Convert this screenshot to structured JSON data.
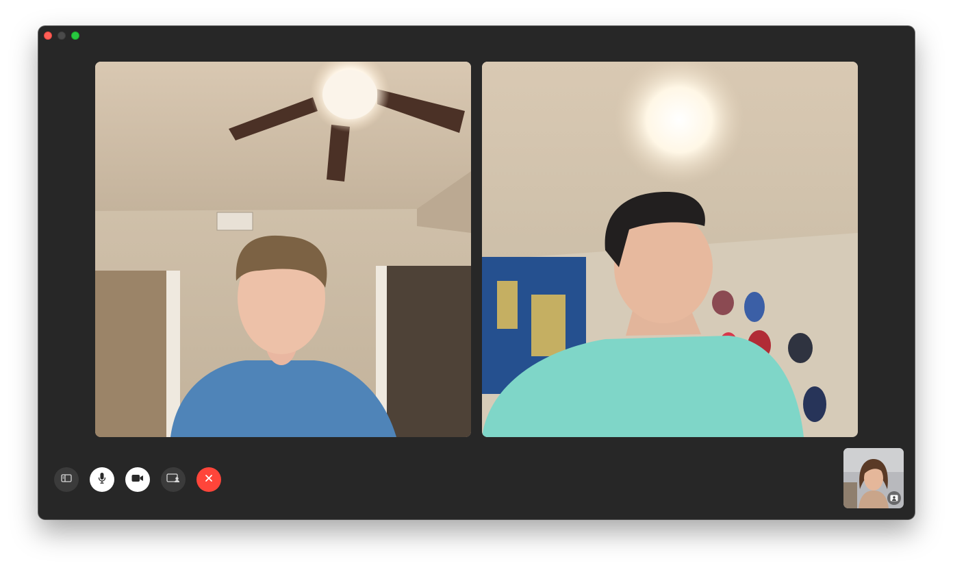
{
  "window": {
    "title_bar": {
      "close": "close",
      "minimize": "minimize",
      "zoom": "zoom"
    }
  },
  "participants": [
    {
      "role": "remote",
      "icon": "video-feed"
    },
    {
      "role": "remote",
      "icon": "video-feed"
    }
  ],
  "self_view": {
    "icon": "self-video-feed",
    "badge_icon": "person-card-icon"
  },
  "controls": [
    {
      "id": "sidebar",
      "icon": "sidebar-icon"
    },
    {
      "id": "mute",
      "icon": "microphone-icon"
    },
    {
      "id": "camera",
      "icon": "video-camera-icon"
    },
    {
      "id": "share-screen",
      "icon": "screen-share-icon"
    },
    {
      "id": "end-call",
      "icon": "close-icon"
    }
  ],
  "colors": {
    "window_bg": "#272727",
    "end_call": "#ff453a",
    "close_light": "#ff5f57",
    "zoom_light": "#28c840"
  }
}
